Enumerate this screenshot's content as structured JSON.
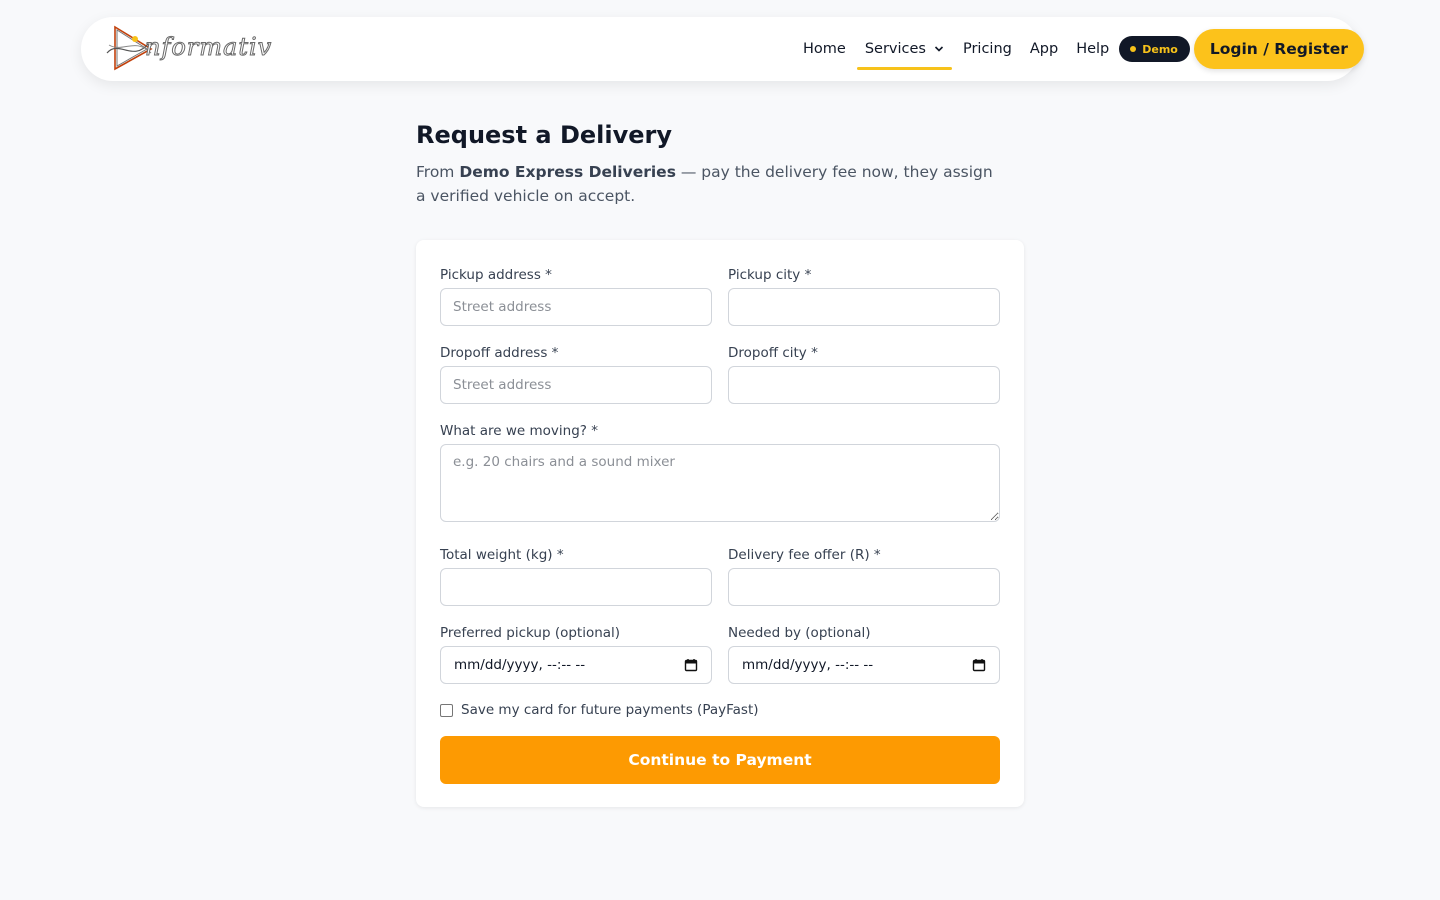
{
  "header": {
    "logo_text": "nformativ",
    "nav": {
      "home": "Home",
      "services": "Services",
      "pricing": "Pricing",
      "app": "App",
      "help": "Help"
    },
    "demo_badge": "Demo",
    "login_label": "Login / Register"
  },
  "page": {
    "title": "Request a Delivery",
    "subtitle_prefix": "From ",
    "company": "Demo Express Deliveries",
    "subtitle_suffix": " — pay the delivery fee now, they assign a verified vehicle on accept."
  },
  "form": {
    "pickup_address": {
      "label": "Pickup address *",
      "placeholder": "Street address",
      "value": ""
    },
    "pickup_city": {
      "label": "Pickup city *",
      "placeholder": "",
      "value": ""
    },
    "dropoff_address": {
      "label": "Dropoff address *",
      "placeholder": "Street address",
      "value": ""
    },
    "dropoff_city": {
      "label": "Dropoff city *",
      "placeholder": "",
      "value": ""
    },
    "moving": {
      "label": "What are we moving? *",
      "placeholder": "e.g. 20 chairs and a sound mixer"
    },
    "weight": {
      "label": "Total weight (kg) *",
      "placeholder": "",
      "value": ""
    },
    "fee": {
      "label": "Delivery fee offer (R) *",
      "placeholder": "",
      "value": ""
    },
    "preferred_pickup": {
      "label": "Preferred pickup (optional)",
      "value": "mm/dd/yyyy, --:-- --"
    },
    "needed_by": {
      "label": "Needed by (optional)",
      "value": "mm/dd/yyyy, --:-- --"
    },
    "save_card_label": "Save my card for future payments (PayFast)",
    "save_card_checked": false,
    "submit_label": "Continue to Payment"
  },
  "colors": {
    "accent_yellow": "#fcc21b",
    "submit_orange": "#fd9a02",
    "dark": "#111827"
  }
}
